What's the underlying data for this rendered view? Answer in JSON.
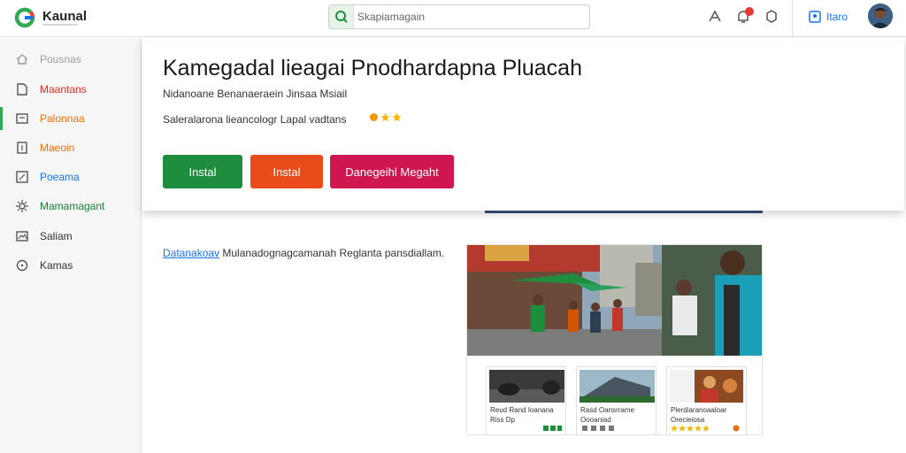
{
  "app": {
    "name": "Kaunal"
  },
  "search": {
    "placeholder": "Skapiamagain"
  },
  "header": {
    "user_label": "Itaro"
  },
  "sidebar": {
    "items": [
      {
        "label": "Pousnas",
        "color": "#9e9e9e",
        "icon": "home-icon"
      },
      {
        "label": "Maantans",
        "color": "#d93025",
        "icon": "file-icon"
      },
      {
        "label": "Palonnaa",
        "color": "#e8710a",
        "icon": "list-icon"
      },
      {
        "label": "Maeoin",
        "color": "#e8710a",
        "icon": "document-icon"
      },
      {
        "label": "Poeama",
        "color": "#1a73e8",
        "icon": "edit-icon"
      },
      {
        "label": "Mamamagant",
        "color": "#188038",
        "icon": "gear-icon"
      },
      {
        "label": "Saliam",
        "color": "#333333",
        "icon": "image-icon"
      },
      {
        "label": "Kamas",
        "color": "#333333",
        "icon": "info-icon"
      }
    ],
    "active_index": 2
  },
  "hero": {
    "title": "Kamegadal lieagai Pnodhardapna Pluacah",
    "subtitle": "Nidanoane Benanaeraein Jinsaa Msiail",
    "meta": "Saleralarona lieancologr Lapal vadtans",
    "rating_stars": 3,
    "buttons": {
      "install_primary": "Instal",
      "install_secondary": "Instal",
      "danger": "Danegeihl Megaht"
    }
  },
  "description": {
    "link": "Datanakoav",
    "text": "Mulanadognagcamanah Reglanta pansdiallam."
  },
  "media": {
    "thumbnails": [
      {
        "line1": "Reud Rand Ioanana",
        "line2": "Riss Dp",
        "footer": "green-icons"
      },
      {
        "line1": "Rasd Oansrrame",
        "line2": "Oooaniad",
        "footer": "grey-icons"
      },
      {
        "line1": "Plerdiaranoaaloar",
        "line2": "Orecieiosa",
        "footer": "stars"
      }
    ]
  }
}
